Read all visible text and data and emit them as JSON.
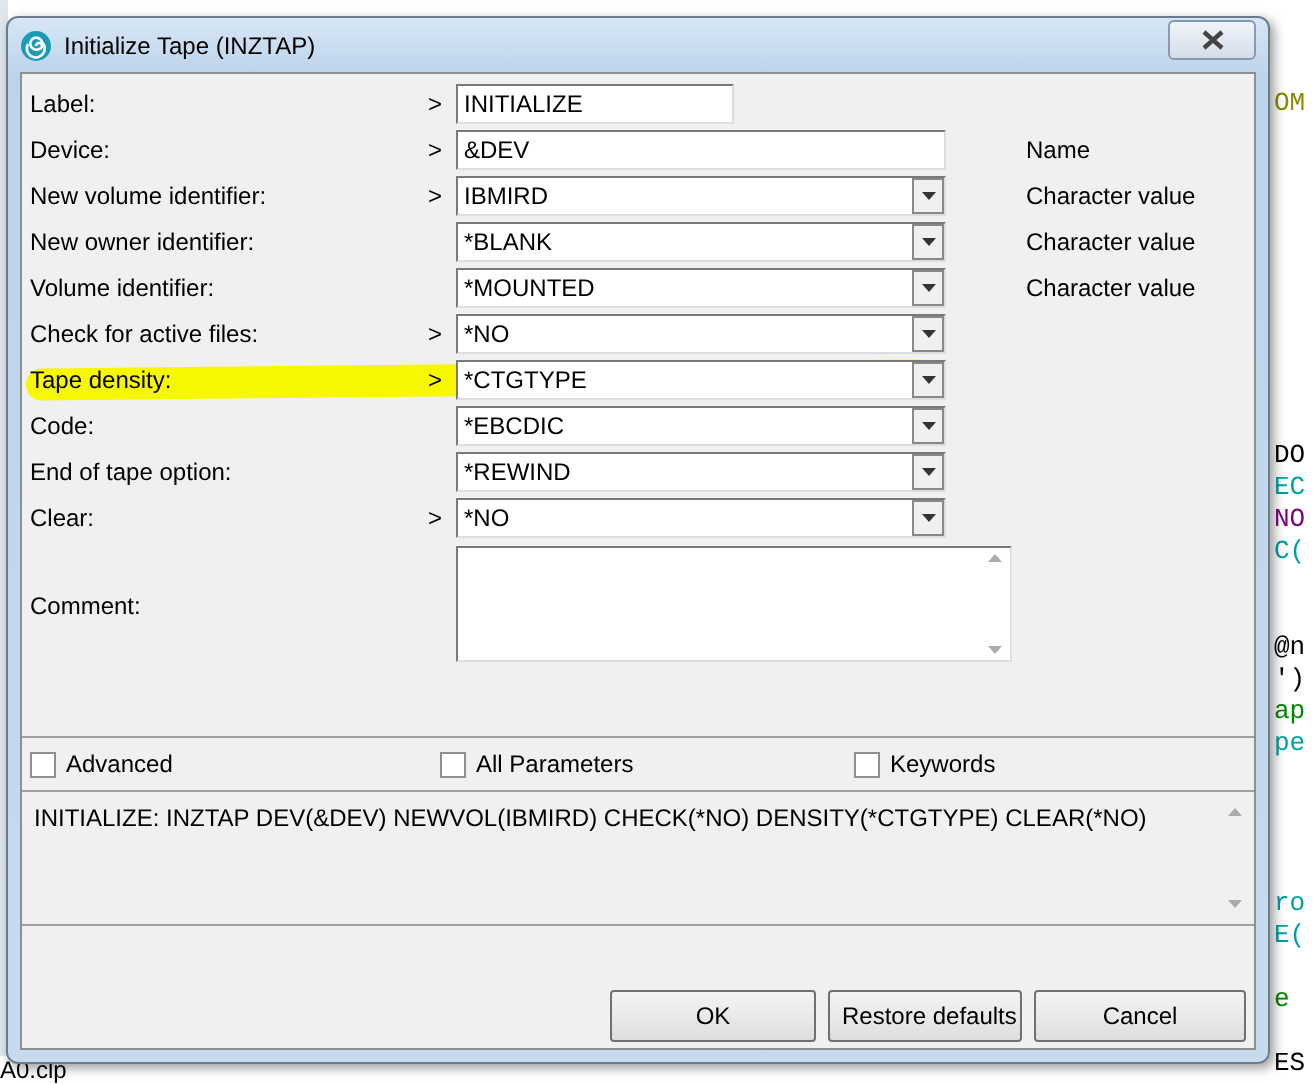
{
  "window": {
    "title": "Initialize Tape (INZTAP)"
  },
  "fields": [
    {
      "label": "Label:",
      "prompt": ">",
      "kind": "short_text",
      "value": "INITIALIZE",
      "highlighted": false
    },
    {
      "label": "Device:",
      "prompt": ">",
      "kind": "text",
      "value": "&DEV",
      "hint": "Name",
      "highlighted": false
    },
    {
      "label": "New volume identifier:",
      "prompt": ">",
      "kind": "combo",
      "value": "IBMIRD",
      "hint": "Character value",
      "highlighted": false
    },
    {
      "label": "New owner identifier:",
      "kind": "combo",
      "value": "*BLANK",
      "hint": "Character value",
      "highlighted": false
    },
    {
      "label": "Volume identifier:",
      "kind": "combo",
      "value": "*MOUNTED",
      "hint": "Character value",
      "highlighted": false
    },
    {
      "label": "Check for active files:",
      "prompt": ">",
      "kind": "combo",
      "value": "*NO",
      "highlighted": false
    },
    {
      "label": "Tape density:",
      "prompt": ">",
      "kind": "combo",
      "value": "*CTGTYPE",
      "highlighted": true
    },
    {
      "label": "Code:",
      "kind": "combo",
      "value": "*EBCDIC",
      "highlighted": false
    },
    {
      "label": "End of tape option:",
      "kind": "combo",
      "value": "*REWIND",
      "highlighted": false
    },
    {
      "label": "Clear:",
      "prompt": ">",
      "kind": "combo",
      "value": "*NO",
      "highlighted": false
    }
  ],
  "comment": {
    "label": "Comment:"
  },
  "options": [
    {
      "label": "Advanced",
      "checked": false
    },
    {
      "label": "All Parameters",
      "checked": false
    },
    {
      "label": "Keywords",
      "checked": false
    }
  ],
  "command_preview": "INITIALIZE: INZTAP DEV(&DEV) NEWVOL(IBMIRD) CHECK(*NO) DENSITY(*CTGTYPE) CLEAR(*NO)",
  "buttons": [
    "OK",
    "Restore defaults",
    "Cancel"
  ],
  "editor_background": {
    "file_name": "A0.clp",
    "lines": [
      {
        "text": "OM",
        "color": "#8a8a00"
      },
      {
        "kind": "blank"
      },
      {
        "kind": "blank"
      },
      {
        "kind": "blank"
      },
      {
        "kind": "blank"
      },
      {
        "kind": "blank"
      },
      {
        "kind": "blank"
      },
      {
        "kind": "blank"
      },
      {
        "kind": "blank"
      },
      {
        "kind": "blank"
      },
      {
        "kind": "blank"
      },
      {
        "text": "DO",
        "color": "#000000"
      },
      {
        "text": "EC",
        "color": "#00a0a0"
      },
      {
        "text": "NO",
        "color": "#800080"
      },
      {
        "text": "C(",
        "color": "#00a0a0"
      },
      {
        "kind": "blank"
      },
      {
        "kind": "blank"
      },
      {
        "text": "@n",
        "color": "#000000"
      },
      {
        "text": "')",
        "color": "#000000"
      },
      {
        "text": "ap",
        "color": "#008800"
      },
      {
        "text": "pe",
        "color": "#00a0a0"
      },
      {
        "kind": "blank"
      },
      {
        "kind": "blank"
      },
      {
        "kind": "blank"
      },
      {
        "kind": "blank"
      },
      {
        "text": "ro",
        "color": "#00a0a0"
      },
      {
        "text": "E(",
        "color": "#00a0a0"
      },
      {
        "kind": "blank"
      },
      {
        "text": "e",
        "color": "#008800"
      },
      {
        "kind": "blank"
      },
      {
        "text": "ES",
        "color": "#000000"
      }
    ]
  }
}
